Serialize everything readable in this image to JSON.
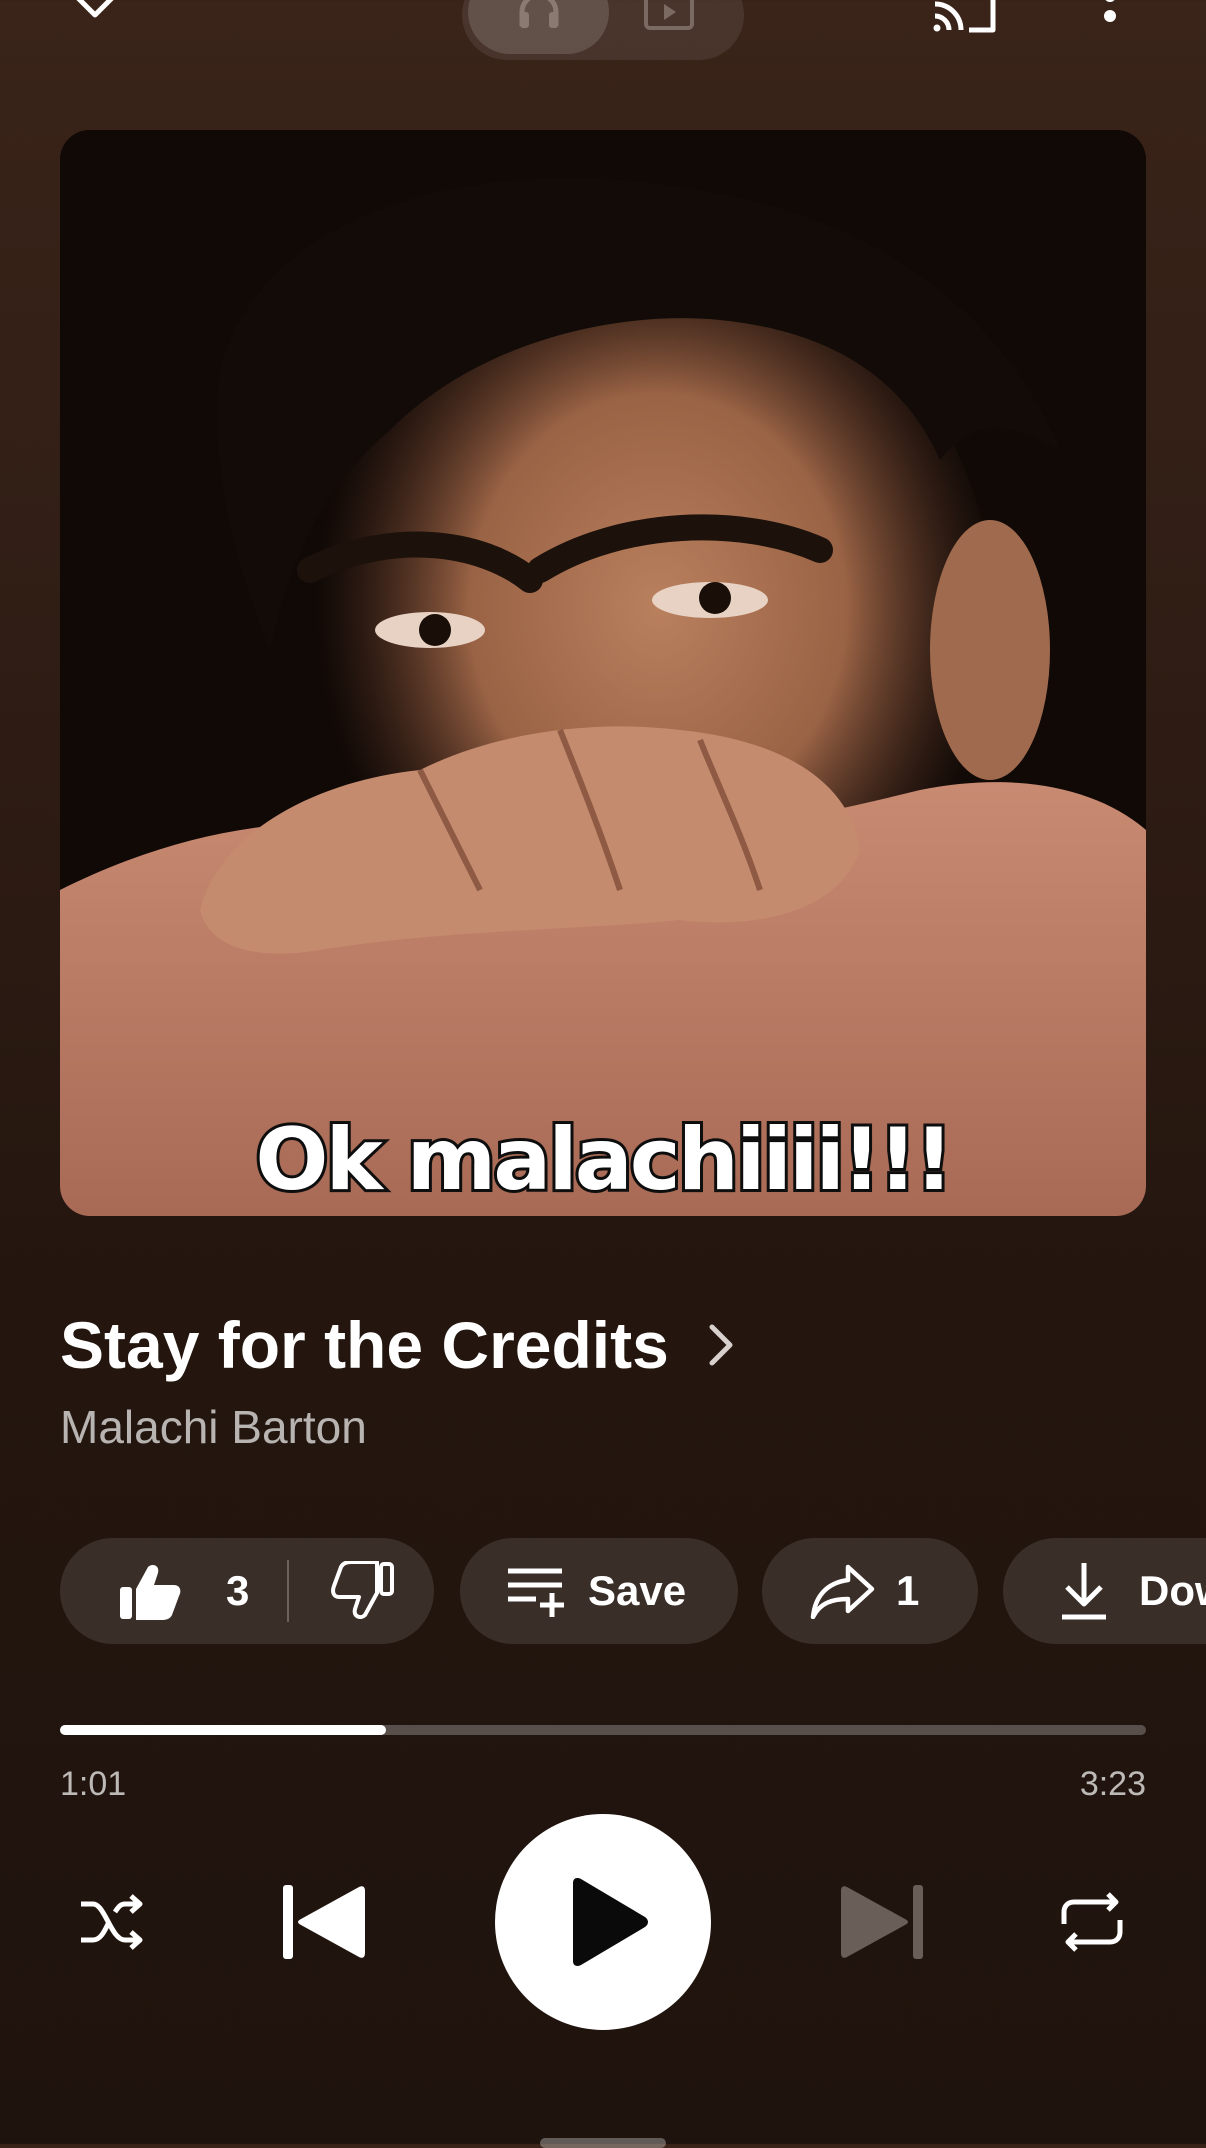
{
  "top_bar": {
    "collapse_icon": "chevron-down-icon",
    "mode_toggle": [
      {
        "name": "audio",
        "icon": "headphones-icon",
        "selected": true
      },
      {
        "name": "video",
        "icon": "video-icon",
        "selected": false
      }
    ],
    "cast_icon": "cast-icon",
    "more_icon": "more-vertical-icon"
  },
  "artwork": {
    "caption": "Ok malachiiii!!!"
  },
  "track": {
    "title": "Stay for the Credits",
    "artist": "Malachi Barton"
  },
  "actions": {
    "like_count": "3",
    "save_label": "Save",
    "share_count": "1",
    "download_label": "Download"
  },
  "playback": {
    "elapsed": "1:01",
    "duration": "3:23",
    "progress_fraction": 0.3,
    "state": "paused"
  },
  "colors": {
    "background_top": "#3a2419",
    "background_bottom": "#1f130d",
    "chip_bg": "rgba(255,255,255,0.11)",
    "text_secondary": "rgba(255,255,255,0.68)"
  }
}
